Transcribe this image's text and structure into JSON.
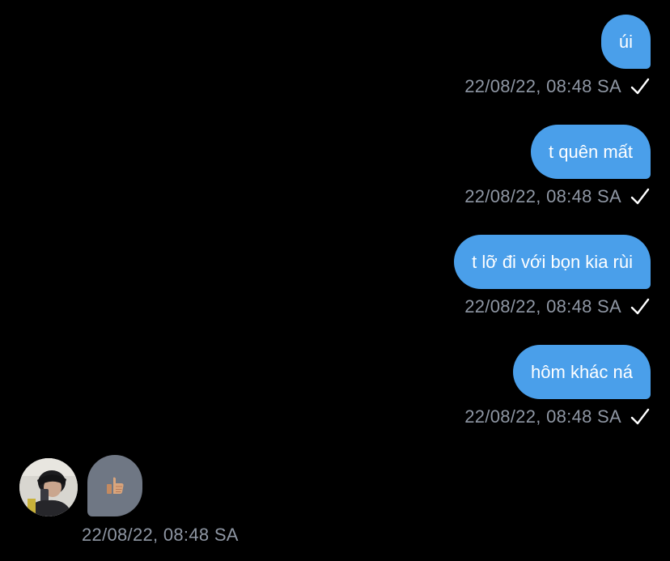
{
  "messages_out": [
    {
      "text": "úi",
      "time": "22/08/22, 08:48 SA",
      "status": "sent"
    },
    {
      "text": "t quên mất",
      "time": "22/08/22, 08:48 SA",
      "status": "sent"
    },
    {
      "text": "t lỡ đi với bọn kia rùi",
      "time": "22/08/22, 08:48 SA",
      "status": "sent"
    },
    {
      "text": "hôm khác ná",
      "time": "22/08/22, 08:48 SA",
      "status": "sent"
    }
  ],
  "message_in": {
    "content": "thumbs-up-icon",
    "time": "22/08/22, 08:48 SA"
  },
  "icons": {
    "status": "check-icon",
    "avatar": "avatar"
  },
  "colors": {
    "background": "#000000",
    "bubble_out": "#4a9fea",
    "bubble_in": "#6f7784",
    "timestamp": "#8e96a3",
    "text": "#ffffff"
  }
}
